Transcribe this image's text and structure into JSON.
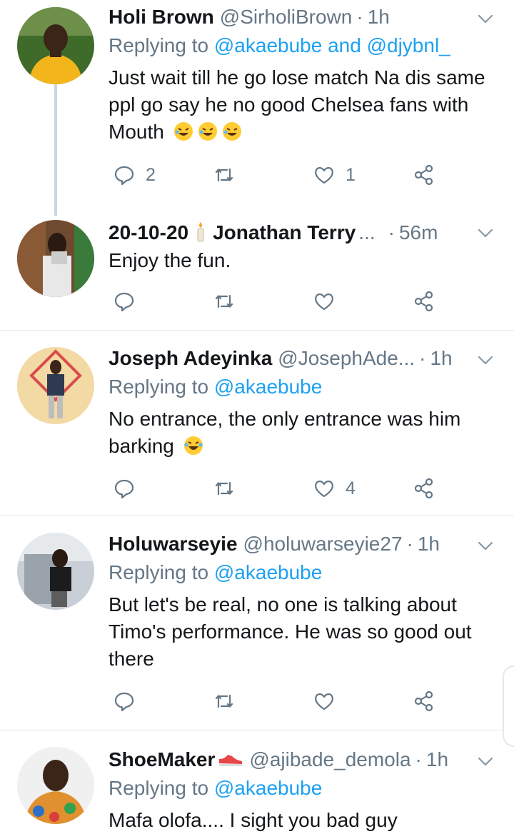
{
  "colors": {
    "accent": "#1da1f2",
    "muted": "#657786",
    "text": "#14171a",
    "divider": "#e1e8ed"
  },
  "icons": {
    "reply": "reply-icon",
    "retweet": "retweet-icon",
    "like": "heart-icon",
    "share": "share-icon",
    "more": "chevron-down-icon"
  },
  "tweets": [
    {
      "name": "Holi Brown",
      "handle": "@SirholiBrown",
      "dot": "·",
      "time": "1h",
      "reply_prefix": "Replying to ",
      "reply_mentions": "@akaebube and @djybnl_",
      "text": "Just wait till he go lose match Na dis same ppl go say he no good  Chelsea fans with Mouth",
      "emoji": "rofl-emoji ×3",
      "reply_count": "2",
      "retweet_count": "",
      "like_count": "1"
    },
    {
      "name": "20-10-20",
      "name_emoji": "candle-emoji",
      "name_suffix": "Jonathan Terry",
      "ellipsis": "...",
      "dot": "·",
      "time": "56m",
      "text": "Enjoy the fun.",
      "reply_count": "",
      "retweet_count": "",
      "like_count": ""
    },
    {
      "name": "Joseph Adeyinka",
      "handle": "@JosephAde...",
      "dot": "·",
      "time": "1h",
      "reply_prefix": "Replying to ",
      "reply_mentions": "@akaebube",
      "text": "No entrance, the only entrance was him barking",
      "emoji": "laughing-emoji",
      "reply_count": "",
      "retweet_count": "",
      "like_count": "4"
    },
    {
      "name": "Holuwarseyie",
      "handle": "@holuwarseyie27",
      "dot": "·",
      "time": "1h",
      "reply_prefix": "Replying to ",
      "reply_mentions": "@akaebube",
      "text": "But let's be real, no one is talking about Timo's performance. He was so good out there",
      "reply_count": "",
      "retweet_count": "",
      "like_count": ""
    },
    {
      "name": "ShoeMaker",
      "name_emoji": "sneaker-emoji",
      "handle": "@ajibade_demola",
      "dot": "·",
      "time": "1h",
      "reply_prefix": "Replying to ",
      "reply_mentions": "@akaebube",
      "text": "Mafa olofa.... I sight you bad guy"
    }
  ]
}
